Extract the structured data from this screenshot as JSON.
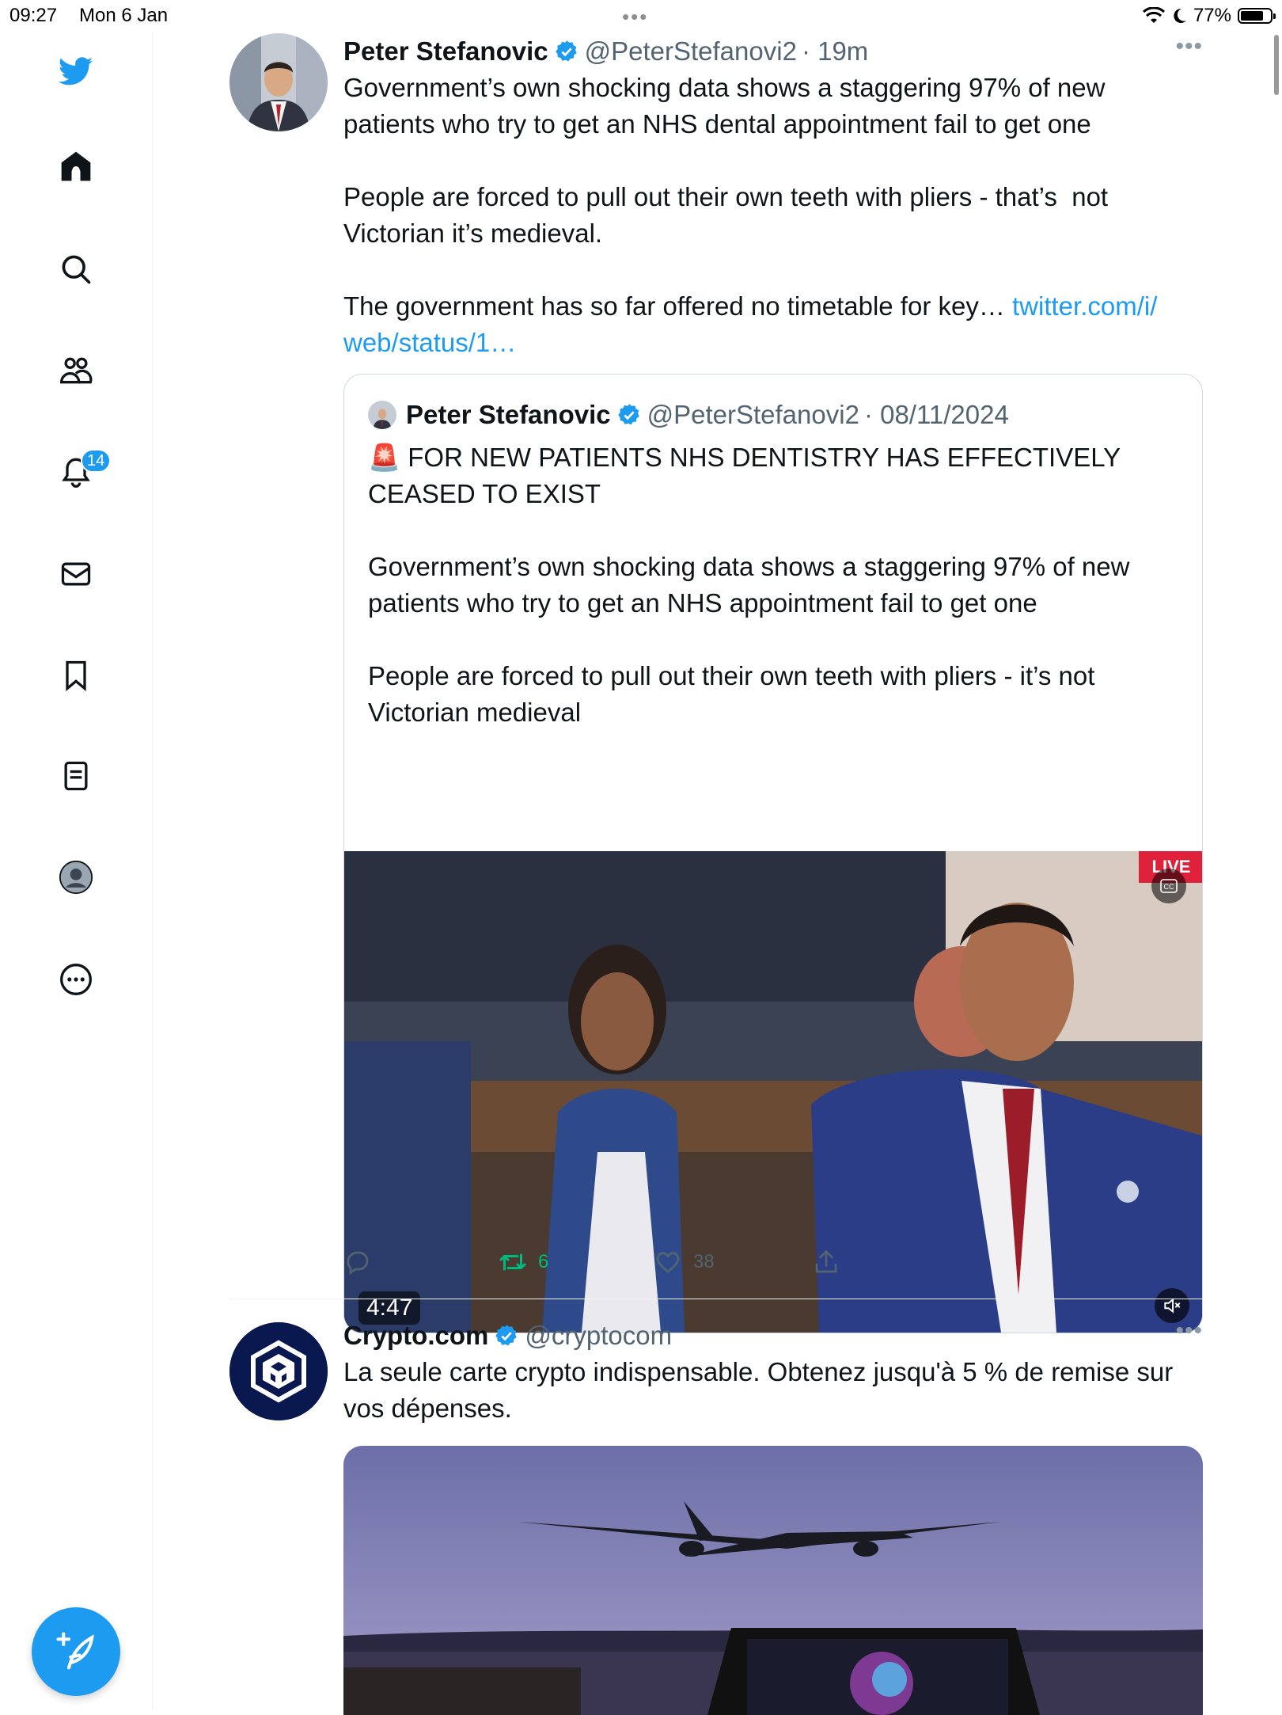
{
  "status_bar": {
    "time": "09:27",
    "date": "Mon 6 Jan",
    "battery": "77%"
  },
  "sidebar": {
    "items": [
      {
        "name": "twitter-logo-icon"
      },
      {
        "name": "home-icon"
      },
      {
        "name": "search-icon"
      },
      {
        "name": "communities-icon"
      },
      {
        "name": "notifications-icon",
        "badge": "14"
      },
      {
        "name": "messages-icon"
      },
      {
        "name": "bookmarks-icon"
      },
      {
        "name": "lists-icon"
      },
      {
        "name": "profile-icon"
      },
      {
        "name": "more-icon"
      }
    ],
    "compose_icon": "compose-icon",
    "accent_color": "#1d9bf0"
  },
  "tweets": [
    {
      "name": "Peter Stefanovic",
      "handle": "@PeterStefanovi2",
      "time": "· 19m",
      "text": "Government’s own shocking data shows a staggering 97% of new patients who try to get an NHS dental appointment fail to get one\n\nPeople are forced to pull out their own teeth with pliers - that’s  not Victorian it’s medieval.\n\nThe government has so far offered no timetable for key… ",
      "link_line1": "twitter.com/i/",
      "link_line2": "web/status/1…",
      "quote": {
        "name": "Peter Stefanovic",
        "handle": "@PeterStefanovi2",
        "time": "· 08/11/2024",
        "text": "🚨 FOR NEW PATIENTS NHS DENTISTRY HAS EFFECTIVELY CEASED TO EXIST\n\nGovernment’s own shocking data shows a staggering 97% of new patients who try to get an NHS appointment fail to get one\n\nPeople are forced to pull out their own teeth with pliers - it’s not Victorian medieval",
        "video_duration": "4:47",
        "live_label": "LIVE"
      },
      "actions": {
        "retweets": "6",
        "likes": "38"
      }
    },
    {
      "name": "Crypto.com",
      "handle": "@cryptocom",
      "text": "La seule carte crypto indispensable. Obtenez jusqu'à 5 % de remise sur vos dépenses."
    }
  ]
}
